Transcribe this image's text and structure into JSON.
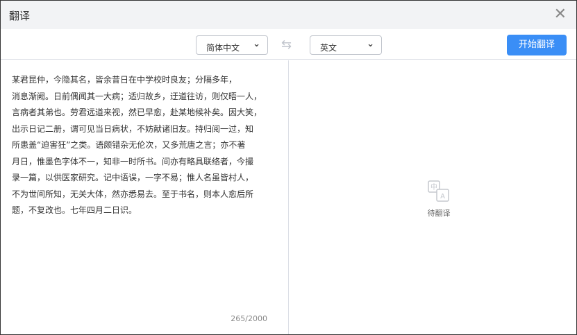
{
  "window": {
    "title": "翻译",
    "close_icon": "close-icon"
  },
  "toolbar": {
    "source_lang": "简体中文",
    "target_lang": "英文",
    "translate_button": "开始翻译"
  },
  "source": {
    "lines": [
      "某君昆仲，今隐其名，皆余昔日在中学校时良友；分隔多年，",
      "消息渐阙。日前偶闻其一大病；适归故乡，迂道往访，则仅晤一人，",
      "言病者其弟也。劳君远道来视，然已早愈，赴某地候补矣。因大笑，",
      "出示日记二册，谓可见当日病状，不妨献诸旧友。持归阅一过，知",
      "所患盖“迫害狂”之类。语颇错杂无伦次，又多荒唐之言；亦不著",
      "月日，惟墨色字体不一，知非一时所书。间亦有略具联络者，今撮",
      "录一篇，以供医家研究。记中语误，一字不易；惟人名虽皆村人，",
      "不为世间所知，无关大体，然亦悉易去。至于书名，则本人愈后所",
      "题，不复改也。七年四月二日识。"
    ],
    "char_count": "265/2000"
  },
  "result": {
    "placeholder": "待翻译"
  },
  "colors": {
    "accent": "#3a8ef6"
  }
}
